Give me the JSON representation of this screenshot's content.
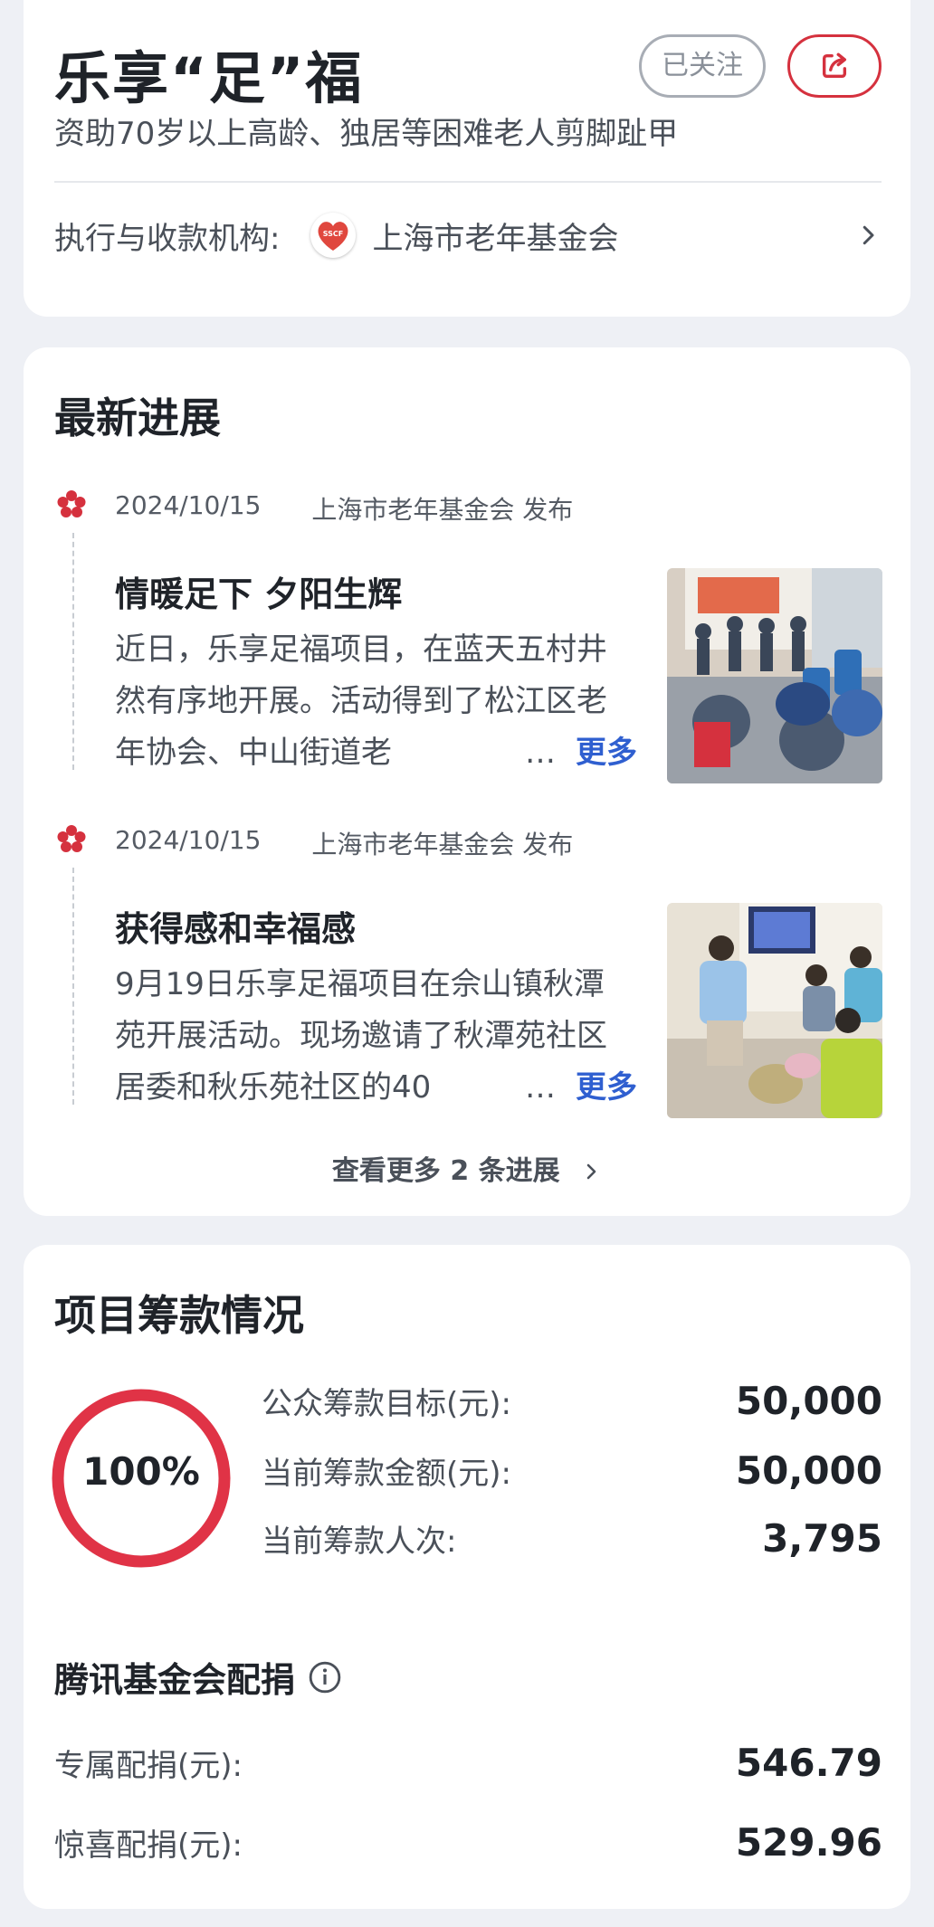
{
  "header": {
    "title": "乐享“足”福",
    "follow_label": "已关注",
    "subtitle": "资助70岁以上高龄、独居等困难老人剪脚趾甲",
    "org_label": "执行与收款机构:",
    "org_logo_text": "SSCF",
    "org_name": "上海市老年基金会",
    "colors": {
      "accent": "#d5313e",
      "link": "#2f5fd0"
    }
  },
  "progress": {
    "title": "最新进展",
    "entries": [
      {
        "date": "2024/10/15",
        "publisher": "上海市老年基金会 发布",
        "title": "情暖足下 夕阳生辉",
        "body": "近日，乐享足福项目，在蓝天五村井然有序地开展。活动得到了松江区老年协会、中山街道老",
        "ellipsis": "…",
        "more": "更多",
        "photo_icon": "group-event-photo"
      },
      {
        "date": "2024/10/15",
        "publisher": "上海市老年基金会 发布",
        "title": "获得感和幸福感",
        "body": "9月19日乐享足福项目在佘山镇秋潭苑开展活动。现场邀请了秋潭苑社区居委和秋乐苑社区的40",
        "ellipsis": "…",
        "more": "更多",
        "photo_icon": "foot-care-photo"
      }
    ],
    "see_more": "查看更多 2 条进展"
  },
  "funds": {
    "title": "项目筹款情况",
    "percent_label": "100%",
    "percent_value": 1.0,
    "stats": [
      {
        "label": "公众筹款目标(元):",
        "value": "50,000"
      },
      {
        "label": "当前筹款金额(元):",
        "value": "50,000"
      },
      {
        "label": "当前筹款人次:",
        "value": "3,795"
      }
    ],
    "match_title": "腾讯基金会配捐",
    "match": [
      {
        "label": "专属配捐(元):",
        "value": "546.79"
      },
      {
        "label": "惊喜配捐(元):",
        "value": "529.96"
      }
    ]
  }
}
